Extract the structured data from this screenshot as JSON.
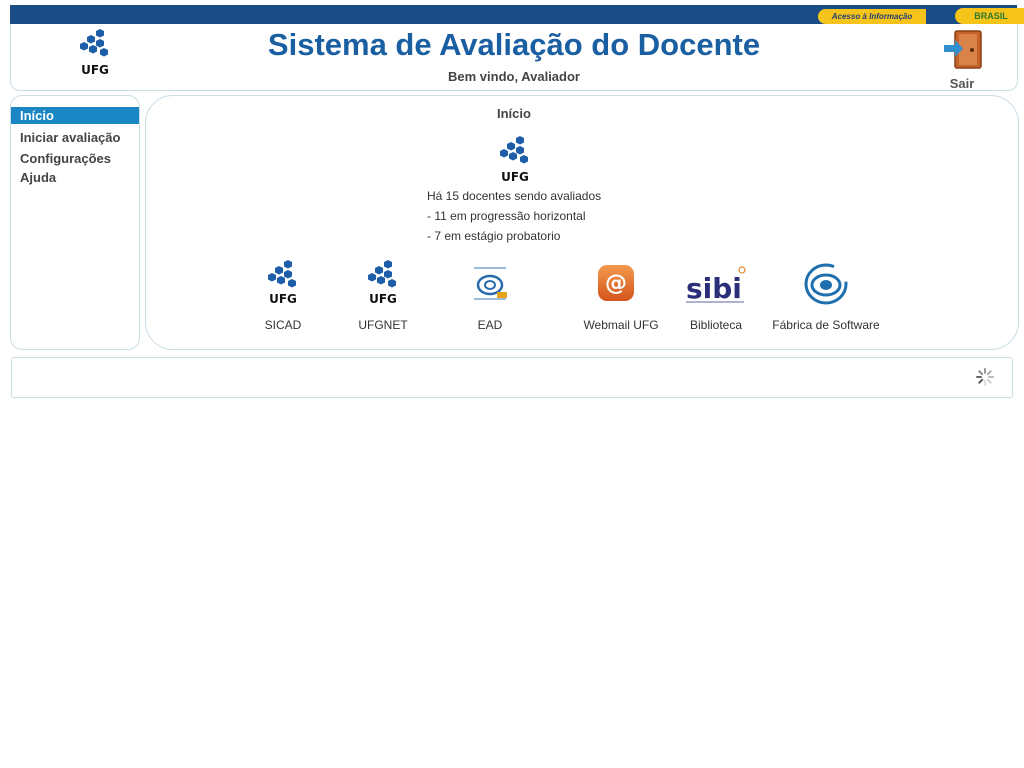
{
  "gov_bar": {
    "access_info": "Acesso à Informação",
    "brasil": "BRASIL"
  },
  "header": {
    "title": "Sistema de Avaliação do Docente",
    "welcome": "Bem vindo, Avaliador",
    "logo_text": "UFG",
    "exit_label": "Sair"
  },
  "sidebar": {
    "items": [
      {
        "label": "Início"
      },
      {
        "label": "Iniciar avaliação"
      },
      {
        "label": "Configurações"
      },
      {
        "label": "Ajuda"
      }
    ]
  },
  "main": {
    "title": "Início",
    "logo_text": "UFG",
    "info": [
      "Há 15 docentes sendo avaliados",
      "- 11 em progressão horizontal",
      "- 7 em estágio probatorio"
    ],
    "links": [
      {
        "label": "SICAD",
        "icon": "ufg-logo-icon",
        "logo_text": "UFG"
      },
      {
        "label": "UFGNET",
        "icon": "ufg-logo-icon",
        "logo_text": "UFG"
      },
      {
        "label": "EAD",
        "icon": "ead-logo-icon"
      },
      {
        "label": "Webmail UFG",
        "icon": "webmail-icon"
      },
      {
        "label": "Biblioteca",
        "icon": "biblioteca-logo-icon"
      },
      {
        "label": "Fábrica de Software",
        "icon": "fabrica-logo-icon"
      }
    ]
  },
  "colors": {
    "title": "#1b5fa3",
    "active_menu": "#1a86c4",
    "gov_bar": "#1a4d85",
    "gov_yellow": "#f6c31b"
  }
}
